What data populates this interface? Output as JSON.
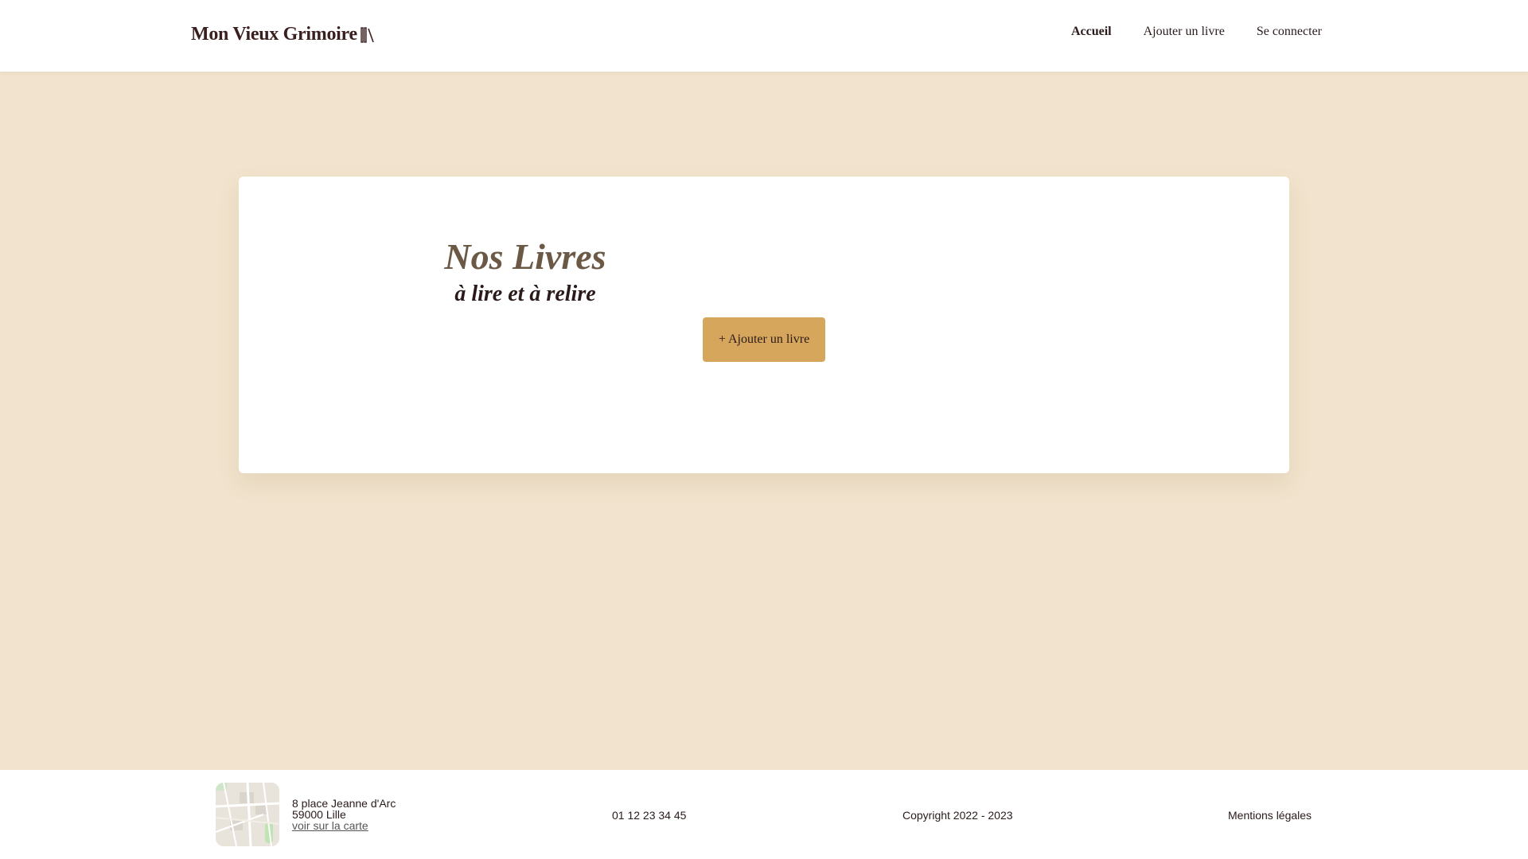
{
  "header": {
    "logo_text": "Mon Vieux Grimoire",
    "logo_icon": "books-icon",
    "nav": [
      {
        "label": "Accueil",
        "active": true
      },
      {
        "label": "Ajouter un livre",
        "active": false
      },
      {
        "label": "Se connecter",
        "active": false
      }
    ]
  },
  "main": {
    "title": "Nos Livres",
    "subtitle": "à lire et à relire",
    "add_button_label": "+ Ajouter un livre"
  },
  "footer": {
    "address_line1": "8 place Jeanne d'Arc",
    "address_line2": "59000 Lille",
    "map_link": "voir sur la carte",
    "phone": "01 12 23 34 45",
    "copyright": "Copyright 2022 - 2023",
    "legal": "Mentions légales"
  },
  "colors": {
    "page_background": "#f1e3cd",
    "button": "#d6a65c",
    "title": "#6b5946",
    "logo": "#3a1f1f"
  }
}
